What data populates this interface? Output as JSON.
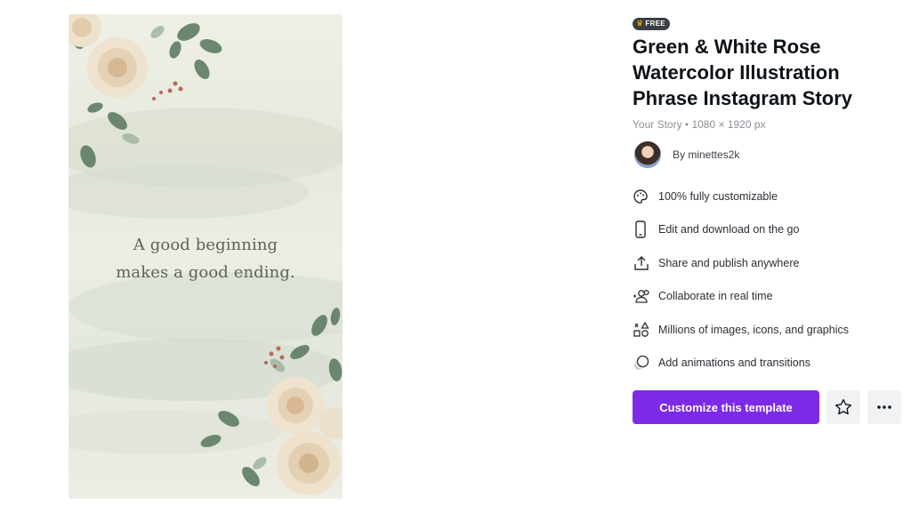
{
  "template": {
    "badge": "FREE",
    "title": "Green & White Rose Watercolor Illustration Phrase Instagram Story",
    "subtitle": "Your Story • 1080 × 1920 px",
    "author": "By minettes2k",
    "preview_quote_line1": "A good beginning",
    "preview_quote_line2": "makes a good ending."
  },
  "features": [
    {
      "icon": "palette-icon",
      "label": "100% fully customizable"
    },
    {
      "icon": "phone-icon",
      "label": "Edit and download on the go"
    },
    {
      "icon": "share-icon",
      "label": "Share and publish anywhere"
    },
    {
      "icon": "collaborate-icon",
      "label": "Collaborate in real time"
    },
    {
      "icon": "elements-icon",
      "label": "Millions of images, icons, and graphics"
    },
    {
      "icon": "animation-icon",
      "label": "Add animations and transitions"
    }
  ],
  "actions": {
    "customize_label": "Customize this template"
  },
  "colors": {
    "accent": "#7d2ae8",
    "badge_bg": "#3a3f44",
    "crown": "#ffb400"
  }
}
